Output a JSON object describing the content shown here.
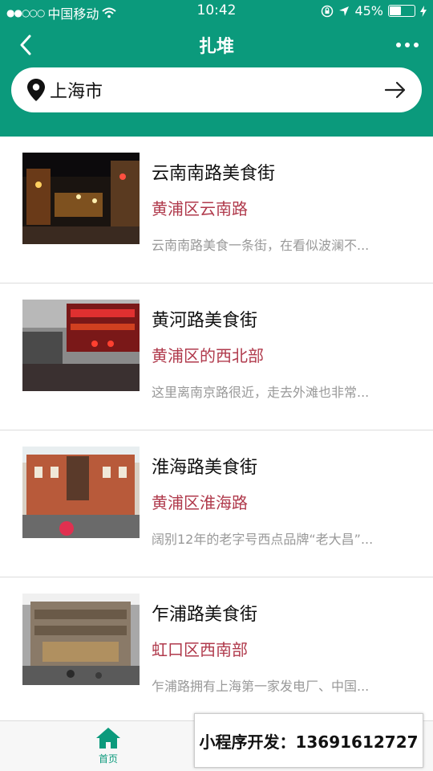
{
  "status_bar": {
    "carrier": "中国移动",
    "time": "10:42",
    "battery_percent": "45%",
    "battery_level": 0.45
  },
  "nav": {
    "title": "扎堆",
    "back_icon": "chevron-left-icon",
    "more_icon": "more-dots-icon"
  },
  "search": {
    "city": "上海市",
    "pin_icon": "location-pin-icon",
    "go_icon": "arrow-right-icon"
  },
  "items": [
    {
      "name": "云南南路美食街",
      "area": "黄浦区云南路",
      "desc": "云南南路美食一条街，在看似波澜不..."
    },
    {
      "name": "黄河路美食街",
      "area": "黄浦区的西北部",
      "desc": "这里离南京路很近，走去外滩也非常..."
    },
    {
      "name": "淮海路美食街",
      "area": "黄浦区淮海路",
      "desc": "阔别12年的老字号西点品牌“老大昌”..."
    },
    {
      "name": "乍浦路美食街",
      "area": "虹口区西南部",
      "desc": "乍浦路拥有上海第一家发电厂、中国..."
    }
  ],
  "tabbar": {
    "home_label": "首页",
    "home_icon": "home-icon"
  },
  "ad_banner": {
    "text": "小程序开发：13691612727"
  },
  "colors": {
    "brand": "#0b9a7c",
    "area_text": "#b03a4c",
    "desc_text": "#999999"
  }
}
